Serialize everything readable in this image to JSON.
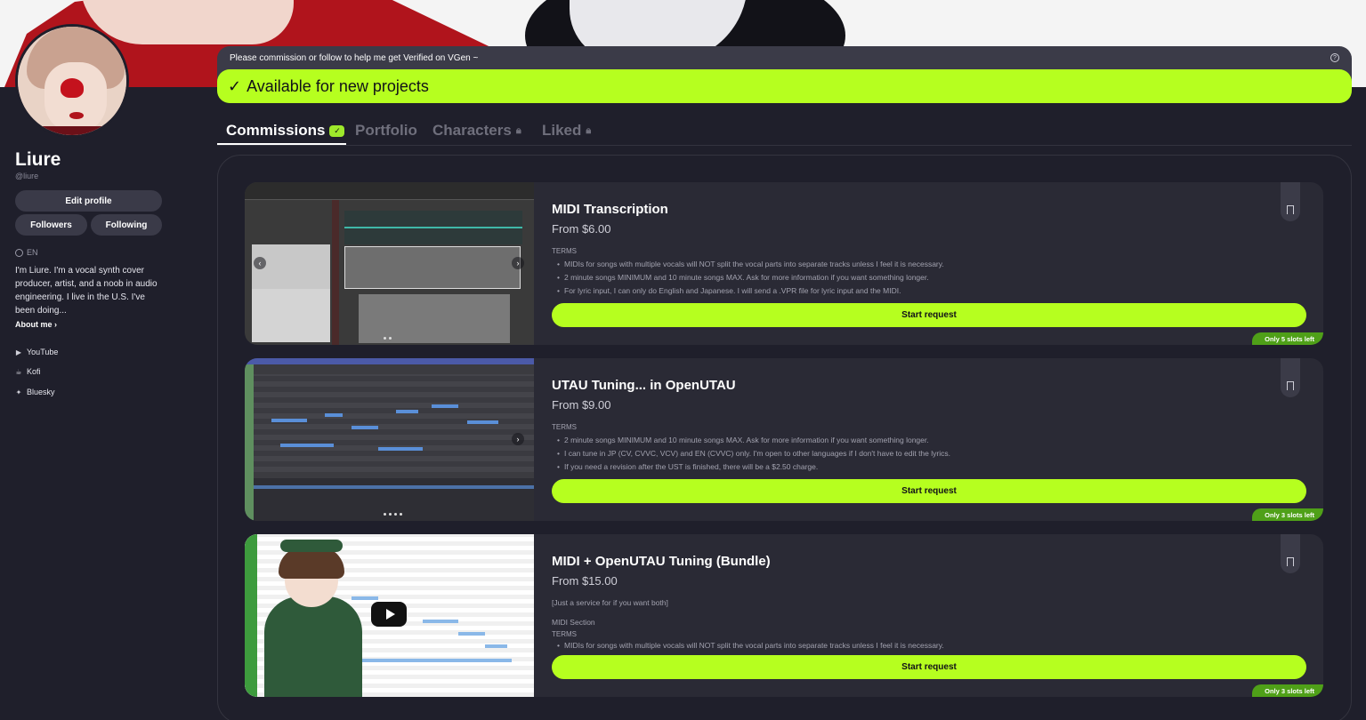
{
  "profile": {
    "name": "Liure",
    "handle": "@liure",
    "edit_profile": "Edit profile",
    "followers": "Followers",
    "following": "Following",
    "language": "EN",
    "bio": "I'm Liure. I'm a vocal synth cover producer, artist, and a noob in audio engineering. I live in the U.S. I've been doing...",
    "about_me": "About me",
    "socials": [
      {
        "label": "YouTube",
        "icon": "youtube-icon"
      },
      {
        "label": "Kofi",
        "icon": "kofi-icon"
      },
      {
        "label": "Bluesky",
        "icon": "bluesky-icon"
      }
    ]
  },
  "notice": {
    "message": "Please commission or follow to help me get Verified on VGen ~",
    "status": "Available for new projects"
  },
  "tabs": [
    {
      "label": "Commissions",
      "active": true,
      "badge": "check"
    },
    {
      "label": "Portfolio",
      "active": false
    },
    {
      "label": "Characters",
      "active": false,
      "locked": true
    },
    {
      "label": "Liked",
      "active": false,
      "locked": true
    }
  ],
  "commissions": [
    {
      "title": "MIDI Transcription",
      "price": "From $6.00",
      "terms_label": "TERMS",
      "terms": [
        "MIDIs for songs with multiple vocals will NOT split the vocal parts into separate tracks unless I feel it is necessary.",
        "2 minute songs MINIMUM and 10 minute songs MAX. Ask for more information if you want something longer.",
        "For lyric input, I can only do English and Japanese. I will send a .VPR file for lyric input and the MIDI."
      ],
      "button": "Start request",
      "slots": "Only 5 slots left"
    },
    {
      "title": "UTAU Tuning... in OpenUTAU",
      "price": "From $9.00",
      "terms_label": "TERMS",
      "terms": [
        "2 minute songs MINIMUM and 10 minute songs MAX. Ask for more information if you want something longer.",
        "I can tune in JP (CV, CVVC, VCV) and EN (CVVC) only. I'm open to other languages if I don't have to edit the lyrics.",
        "If you need a revision after the UST is finished, there will be a $2.50 charge."
      ],
      "button": "Start request",
      "slots": "Only 3 slots left"
    },
    {
      "title": "MIDI + OpenUTAU Tuning (Bundle)",
      "price": "From $15.00",
      "note": "[Just a service for if you want both]",
      "section": "MIDI Section",
      "terms_label": "TERMS",
      "terms": [
        "MIDIs for songs with multiple vocals will NOT split the vocal parts into separate tracks unless I feel it is necessary."
      ],
      "button": "Start request",
      "slots": "Only 3 slots left"
    }
  ],
  "colors": {
    "accent": "#b6ff1f",
    "background": "#1f1f2b",
    "card": "#2a2a35",
    "slots_badge": "#4fa018"
  }
}
